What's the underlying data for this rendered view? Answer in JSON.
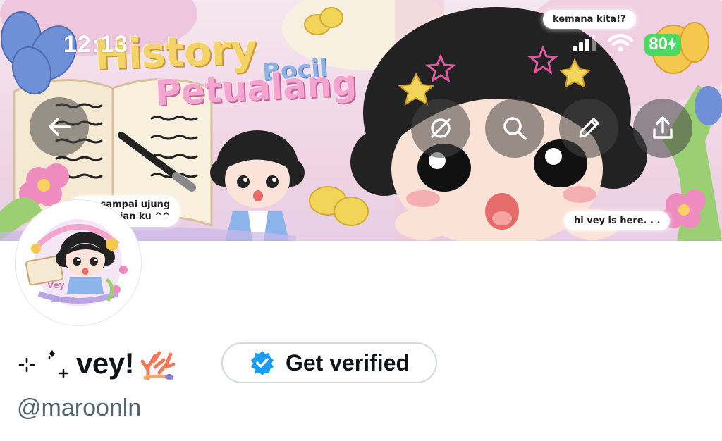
{
  "status_bar": {
    "time": "12:13",
    "battery": "80",
    "icons": [
      "signal-icon",
      "wifi-icon",
      "battery-charging-icon"
    ]
  },
  "banner": {
    "title_line1": "History",
    "title_word2": "Bocil",
    "title_line2": "Petualang",
    "bubble_top": "kemana kita!?",
    "bubble_bottom": "hi vey is here. . .",
    "bubble_left_line1": "...n sampai ujung",
    "bubble_left_line2": "...h impian ku ^^"
  },
  "toolbar": {
    "back_icon": "arrow-left-icon",
    "follow_icon": "circular-arrows-icon",
    "search_icon": "search-icon",
    "edit_icon": "pencil-icon",
    "share_icon": "share-icon"
  },
  "avatar": {
    "caption_line1": "Vey",
    "caption_line2": "Store"
  },
  "profile": {
    "display_name": "vey!",
    "handle": "@maroonln"
  },
  "verify": {
    "label": "Get verified"
  },
  "colors": {
    "text_primary": "#0f1419",
    "text_secondary": "#536471",
    "verified_blue": "#1d9bf0",
    "battery_green": "#4cd964"
  }
}
